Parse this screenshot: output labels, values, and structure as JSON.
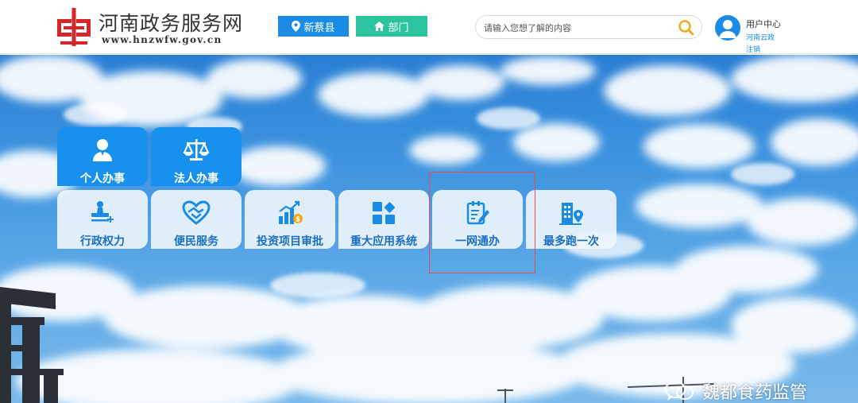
{
  "header": {
    "site_title": "河南政务服务网",
    "site_url": "www.hnzwfw.gov.cn",
    "region_button": "新蔡县",
    "dept_button": "部门",
    "search_placeholder": "请输入您想了解的内容",
    "user_center": "用户中心",
    "user_name": "河南云政",
    "logout": "注销"
  },
  "tiles_primary": [
    {
      "label": "个人办事",
      "icon": "person-icon"
    },
    {
      "label": "法人办事",
      "icon": "scales-icon"
    }
  ],
  "tiles_secondary": [
    {
      "label": "行政权力",
      "icon": "stamp-icon"
    },
    {
      "label": "便民服务",
      "icon": "handshake-heart-icon"
    },
    {
      "label": "投资项目审批",
      "icon": "growth-chart-icon"
    },
    {
      "label": "重大应用系统",
      "icon": "apps-grid-icon"
    },
    {
      "label": "一网通办",
      "icon": "edit-document-icon"
    },
    {
      "label": "最多跑一次",
      "icon": "building-location-icon"
    }
  ],
  "watermark": "魏都食药监管",
  "colors": {
    "primary_blue": "#1891ee",
    "button_blue": "#1a8ce6",
    "button_green": "#2bc49e",
    "logo_red": "#d8252a",
    "highlight_red": "#e05050"
  }
}
